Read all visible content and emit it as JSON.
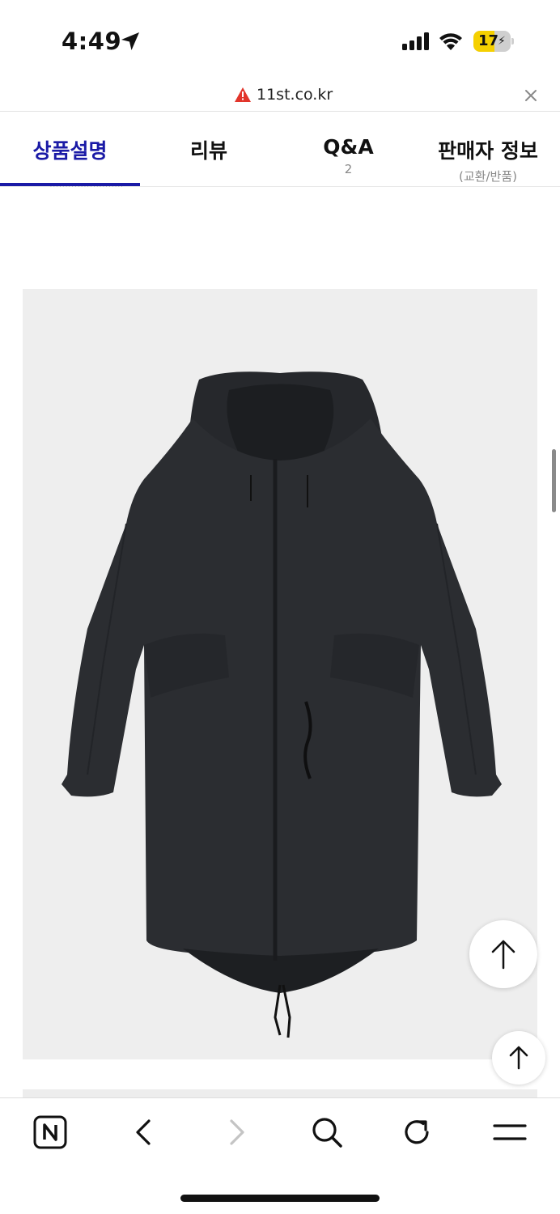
{
  "status_bar": {
    "time": "4:49",
    "battery_level": "17",
    "battery_color": "#f5d000"
  },
  "url_bar": {
    "domain": "11st.co.kr",
    "warning_icon": "warning-icon",
    "close_icon": "close-icon"
  },
  "tabs": [
    {
      "label": "상품설명",
      "sub": ""
    },
    {
      "label": "리뷰",
      "sub": ""
    },
    {
      "label": "Q&A",
      "sub": "2"
    },
    {
      "label": "판매자 정보",
      "sub": "(교환/반품)"
    }
  ],
  "tabs_active_index": 0,
  "accent_color": "#1a1aa6",
  "product": {
    "image_icon": "jacket-image"
  },
  "floating_buttons": {
    "scroll_top_large_icon": "arrow-up-icon",
    "scroll_top_small_icon": "arrow-up-icon"
  },
  "toolbar": {
    "items": [
      "naver-n-icon",
      "back-icon",
      "forward-icon",
      "search-icon",
      "reload-icon",
      "menu-icon"
    ]
  }
}
